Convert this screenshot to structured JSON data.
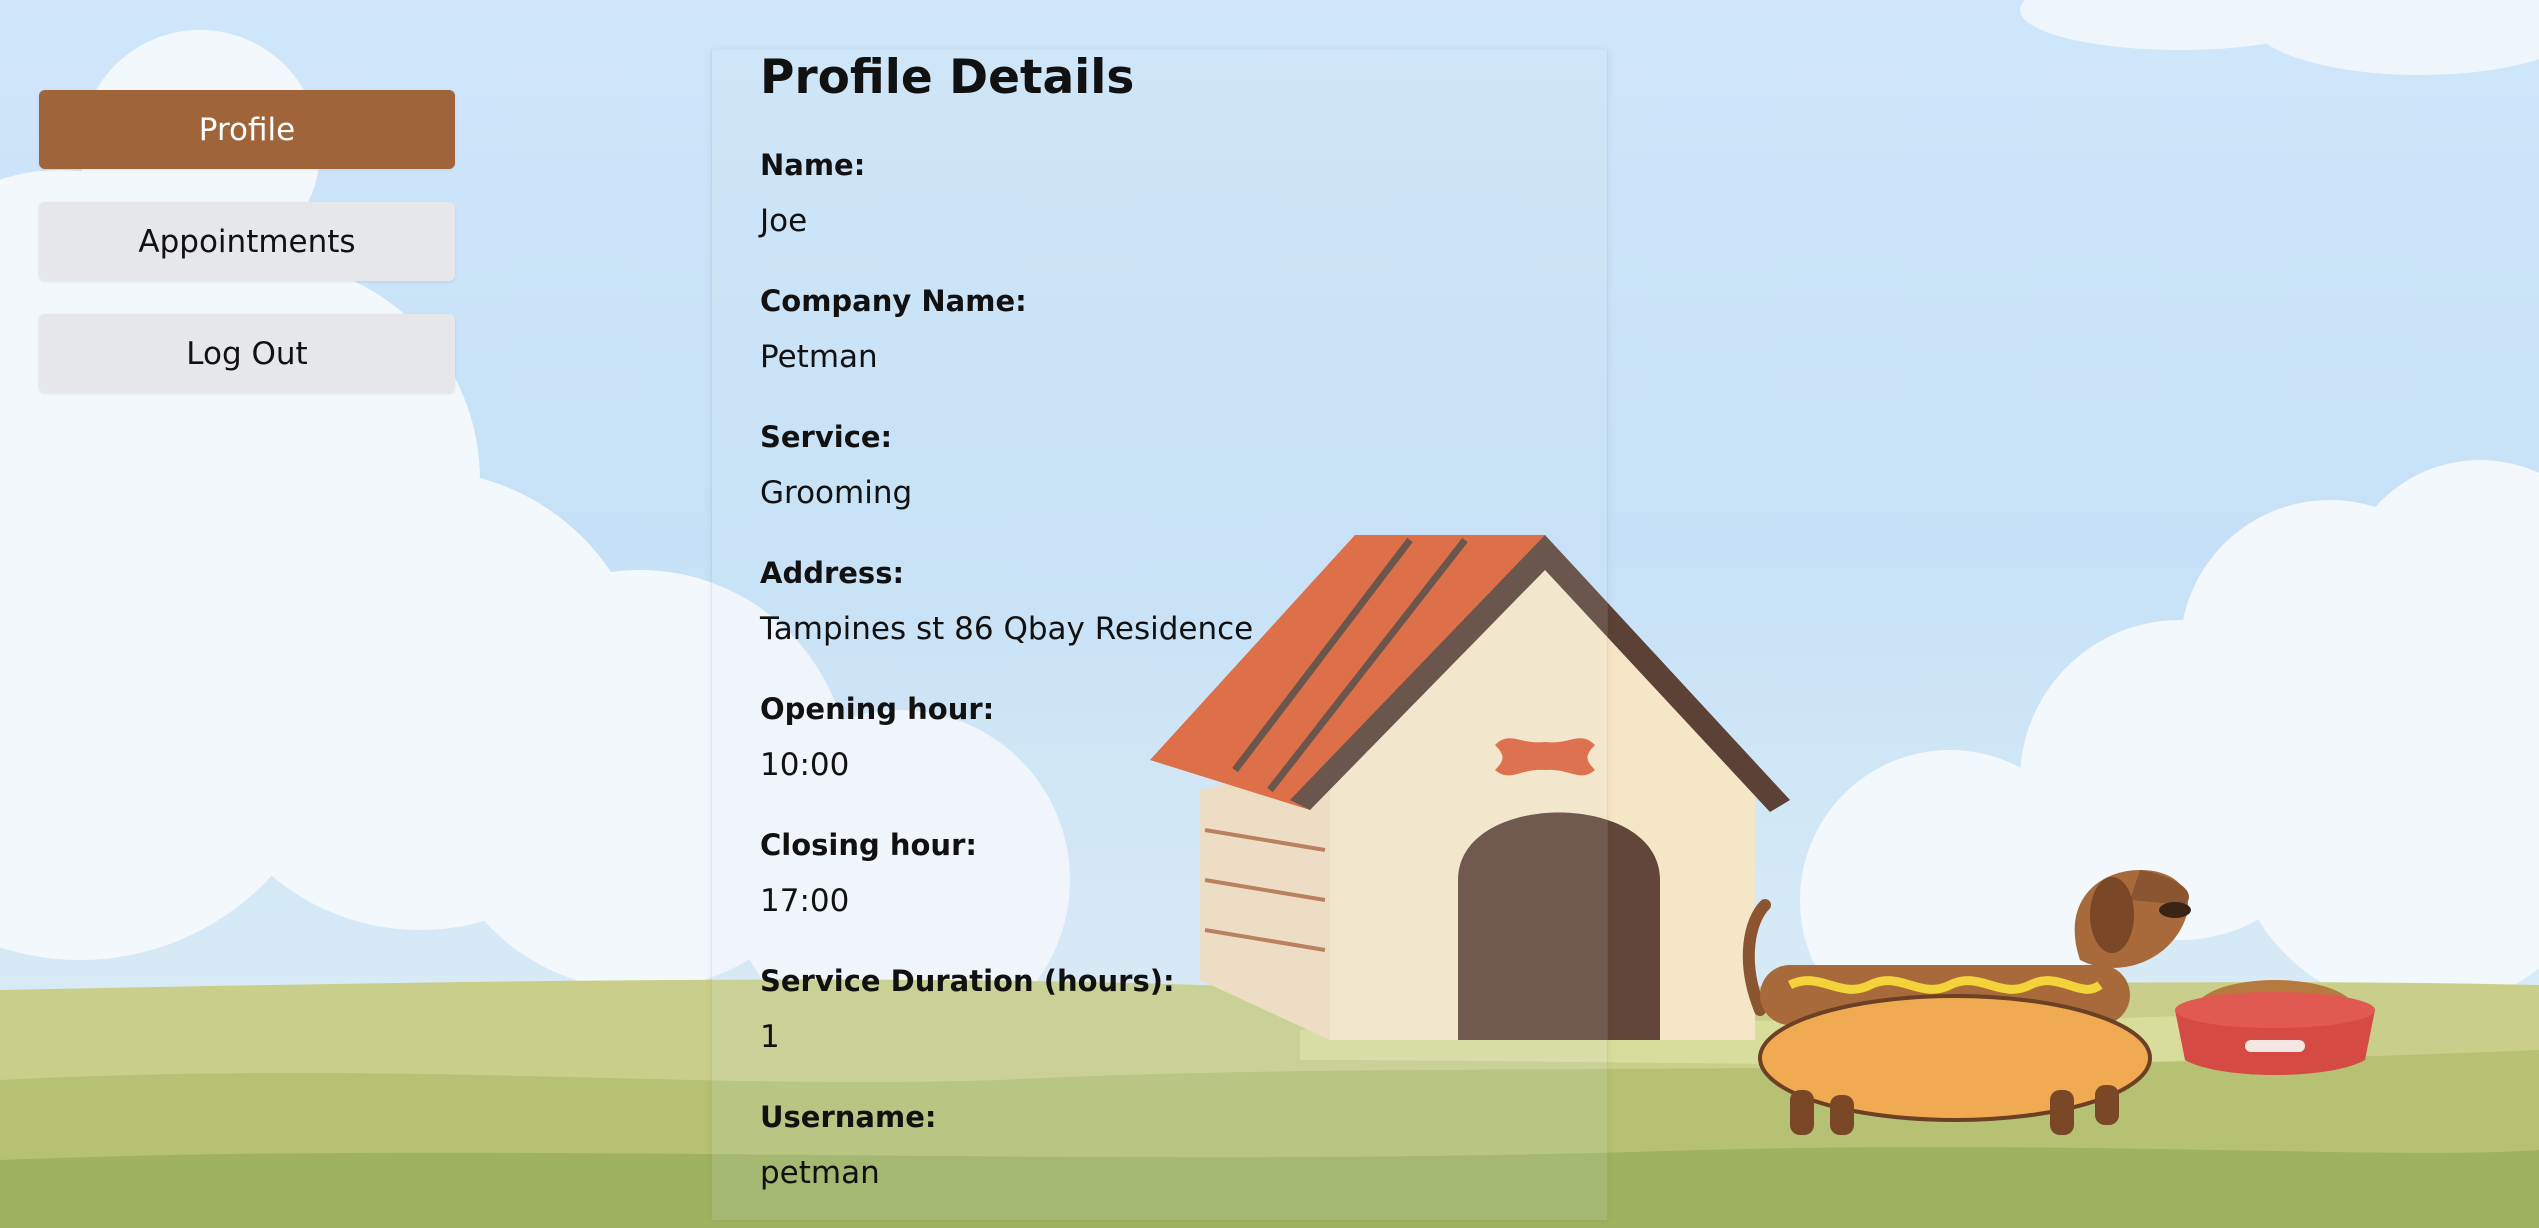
{
  "sidebar": {
    "items": [
      {
        "label": "Profile",
        "active": true
      },
      {
        "label": "Appointments",
        "active": false
      },
      {
        "label": "Log Out",
        "active": false
      }
    ]
  },
  "profile": {
    "title": "Profile Details",
    "fields": [
      {
        "label": "Name:",
        "value": "Joe"
      },
      {
        "label": "Company Name:",
        "value": "Petman"
      },
      {
        "label": "Service:",
        "value": "Grooming"
      },
      {
        "label": "Address:",
        "value": "Tampines st 86 Qbay Residence"
      },
      {
        "label": "Opening hour:",
        "value": "10:00"
      },
      {
        "label": "Closing hour:",
        "value": "17:00"
      },
      {
        "label": "Service Duration (hours):",
        "value": "1"
      },
      {
        "label": "Username:",
        "value": "petman"
      }
    ]
  },
  "colors": {
    "accent": "#a0643b",
    "button_bg": "#e6e7ea",
    "sky": "#c6e1f7",
    "grass": "#b8c37a"
  }
}
